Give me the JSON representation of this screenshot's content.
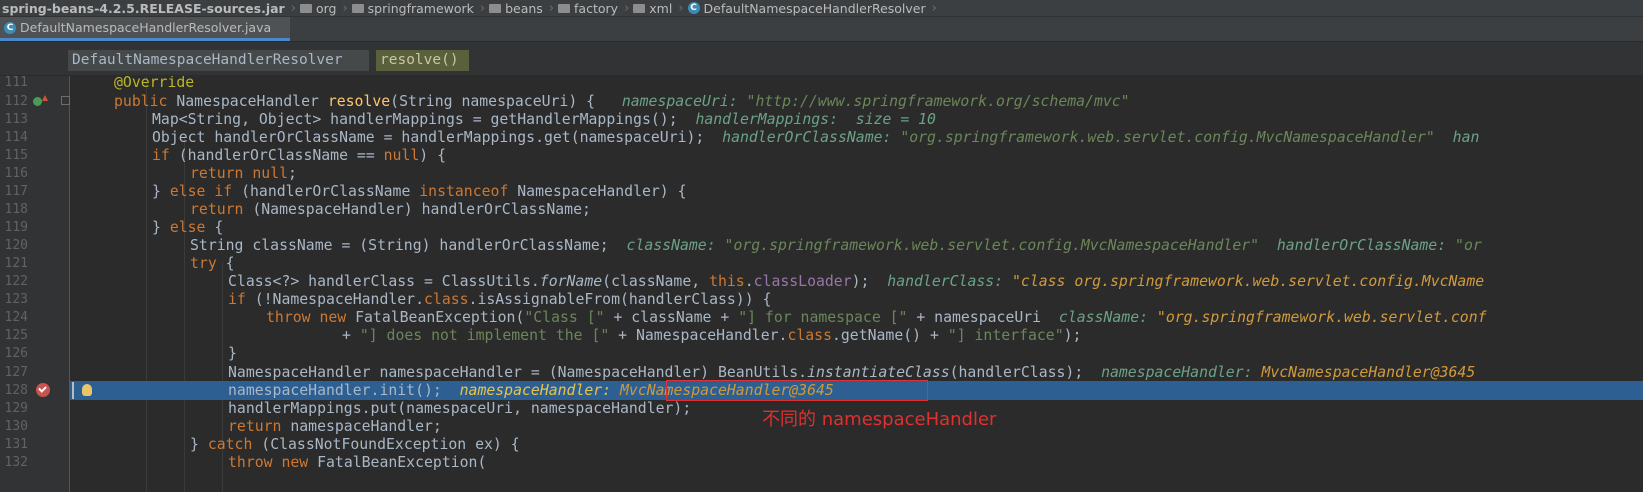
{
  "breadcrumb": {
    "items": [
      "spring-beans-4.2.5.RELEASE-sources.jar",
      "org",
      "springframework",
      "beans",
      "factory",
      "xml",
      "DefaultNamespaceHandlerResolver"
    ]
  },
  "tab": {
    "label": "DefaultNamespaceHandlerResolver.java"
  },
  "structure": {
    "class_name": "DefaultNamespaceHandlerResolver",
    "method_name": "resolve()"
  },
  "line_numbers": [
    "111",
    "112",
    "113",
    "114",
    "115",
    "116",
    "117",
    "118",
    "119",
    "120",
    "121",
    "122",
    "123",
    "124",
    "125",
    "126",
    "127",
    "128",
    "129",
    "130",
    "131",
    "132"
  ],
  "code": {
    "l111": {
      "ann": "@Override"
    },
    "l112": {
      "kw": "public",
      "t1": " NamespaceHandler ",
      "fn": "resolve",
      "t2": "(String namespaceUri) {",
      "hint_k": "namespaceUri: ",
      "hint_v": "\"http://www.springframework.org/schema/mvc\""
    },
    "l113": {
      "t1": "Map<String, Object> handlerMappings = getHandlerMappings();",
      "hint_k": "handlerMappings:  size = 10"
    },
    "l114": {
      "t1": "Object handlerOrClassName = handlerMappings.get(namespaceUri);",
      "hint_k": "handlerOrClassName: ",
      "hint_v": "\"org.springframework.web.servlet.config.MvcNamespaceHandler\"",
      "hint_k2": "  han"
    },
    "l115": {
      "kw": "if",
      "t1": " (handlerOrClassName == ",
      "kw2": "null",
      "t2": ") {"
    },
    "l116": {
      "kw": "return",
      "t1": " ",
      "kw2": "null",
      "t2": ";"
    },
    "l117": {
      "t0": "} ",
      "kw": "else if",
      "t1": " (handlerOrClassName ",
      "kw2": "instanceof",
      "t2": " NamespaceHandler) {"
    },
    "l118": {
      "kw": "return",
      "t1": " (NamespaceHandler) handlerOrClassName;"
    },
    "l119": {
      "t0": "} ",
      "kw": "else",
      "t1": " {"
    },
    "l120": {
      "t1": "String className = (String) handlerOrClassName;",
      "hint_k": "className: ",
      "hint_v": "\"org.springframework.web.servlet.config.MvcNamespaceHandler\"",
      "hint_k2": "  handlerOrClassName: ",
      "hint_v2": "\"or"
    },
    "l121": {
      "kw": "try",
      "t1": " {"
    },
    "l122": {
      "t1": "Class<?> handlerClass = ClassUtils.",
      "it": "forName",
      "t2": "(className, ",
      "kw": "this",
      "t3": ".",
      "fld": "classLoader",
      "t4": ");",
      "hint_k": "handlerClass: ",
      "hint_v": "\"class org.springframework.web.servlet.config.MvcName"
    },
    "l123": {
      "kw": "if",
      "t1": " (!NamespaceHandler.",
      "kw2": "class",
      "t2": ".isAssignableFrom(handlerClass)) {"
    },
    "l124": {
      "kw": "throw new",
      "t1": " FatalBeanException(",
      "s1": "\"Class [\"",
      "t2": " + className + ",
      "s2": "\"] for namespace [\"",
      "t3": " + namespaceUri",
      "hint_k": "className: ",
      "hint_v": "\"org.springframework.web.servlet.conf"
    },
    "l125": {
      "t1": "+ ",
      "s1": "\"] does not implement the [\"",
      "t2": " + NamespaceHandler.",
      "kw": "class",
      "t3": ".getName() + ",
      "s2": "\"] interface\"",
      "t4": ");"
    },
    "l126": {
      "t1": "}"
    },
    "l127": {
      "t1": "NamespaceHandler namespaceHandler = (NamespaceHandler) BeanUtils.",
      "it": "instantiateClass",
      "t2": "(handlerClass);",
      "hint_k": "namespaceHandler: ",
      "hint_v": "MvcNamespaceHandler@3645"
    },
    "l128": {
      "t1": "namespaceHandler.init();",
      "hint_k": "namespaceHandler: ",
      "hint_v": "MvcNamespaceHandler@3645"
    },
    "l129": {
      "t1": "handlerMappings.put(namespaceUri, namespaceHandler);"
    },
    "l130": {
      "kw": "return",
      "t1": " namespaceHandler;"
    },
    "l131": {
      "t0": "} ",
      "kw": "catch",
      "t1": " (ClassNotFoundException ex) {"
    },
    "l132": {
      "kw": "throw new",
      "t1": " FatalBeanException("
    }
  },
  "annotation": {
    "text": "不同的 namespaceHandler",
    "color": "#e0302f"
  },
  "colors": {
    "keyword": "#cc7832",
    "string": "#6a8759",
    "method": "#ffc66d",
    "selection": "#2d5f93",
    "breakpoint": "#c75450"
  }
}
